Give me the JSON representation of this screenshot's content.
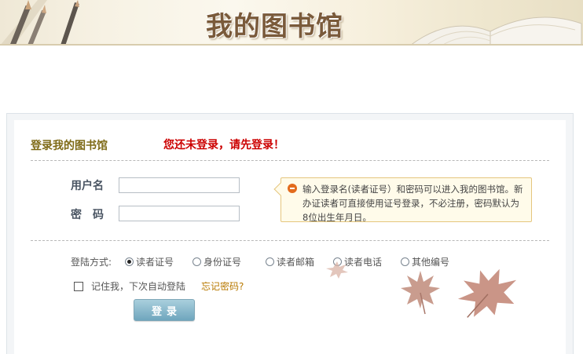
{
  "banner": {
    "title": "我的图书馆"
  },
  "login": {
    "title": "登录我的图书馆",
    "warning": "您还未登录，请先登录！",
    "username_label": "用户名",
    "password_label": "密　码",
    "username_value": "",
    "password_value": "",
    "tip": "输入登录名(读者证号）和密码可以进入我的图书馆。新办证读者可直接使用证号登录，不必注册，密码默认为8位出生年月日。",
    "method_label": "登陆方式:",
    "methods": [
      {
        "label": "读者证号",
        "selected": true
      },
      {
        "label": "身份证号",
        "selected": false
      },
      {
        "label": "读者邮箱",
        "selected": false
      },
      {
        "label": "读者电话",
        "selected": false
      },
      {
        "label": "其他编号",
        "selected": false
      }
    ],
    "remember_label": "记住我，下次自动登陆",
    "remember_checked": false,
    "forgot_label": "忘记密码?",
    "submit_label": "登录"
  },
  "colors": {
    "title": "#7e6a16",
    "warning": "#cc0000",
    "forgot_link": "#b87900",
    "button": "#6fa6bd",
    "tip_background": "#fffbea",
    "tip_icon": "#e36b1d"
  },
  "icons": {
    "tip": "minus-circle-icon",
    "banner_left": "pencils-icon",
    "banner_right": "open-book-icon",
    "decor": "maple-leaf-icon"
  }
}
